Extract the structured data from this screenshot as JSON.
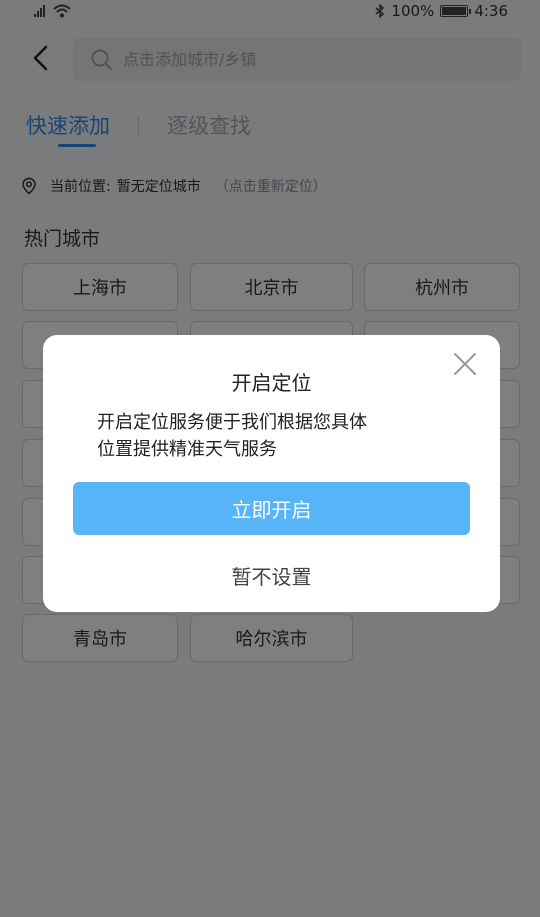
{
  "status_bar": {
    "battery": "100%",
    "time": "4:36"
  },
  "search": {
    "placeholder": "点击添加城市/乡镇"
  },
  "tabs": [
    {
      "label": "快速添加",
      "active": true
    },
    {
      "label": "逐级查找",
      "active": false
    }
  ],
  "location": {
    "label": "当前位置:",
    "value": "暂无定位城市",
    "hint": "（点击重新定位）"
  },
  "hot_cities": {
    "title": "热门城市",
    "visible_cities": [
      "上海市",
      "北京市",
      "杭州市",
      "青岛市",
      "哈尔滨市"
    ]
  },
  "dialog": {
    "title": "开启定位",
    "message_line1": "开启定位服务便于我们根据您具体",
    "message_line2": "位置提供精准天气服务",
    "confirm_label": "立即开启",
    "cancel_label": "暂不设置"
  },
  "colors": {
    "accent": "#2d8cf0",
    "button": "#56b4f7"
  }
}
